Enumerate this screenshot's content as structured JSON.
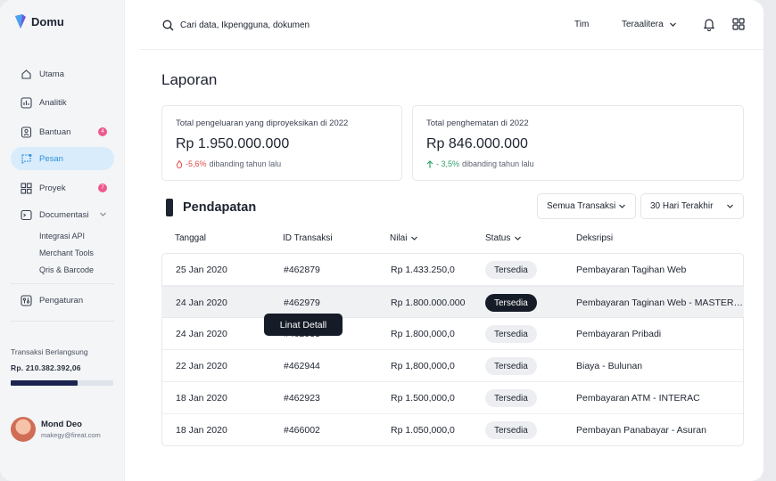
{
  "app": {
    "brand": "Domu"
  },
  "sidebar": {
    "items": [
      {
        "label": "Utama",
        "icon": "home-icon"
      },
      {
        "label": "Analitik",
        "icon": "chart-icon"
      },
      {
        "label": "Bantuan",
        "icon": "help-icon",
        "badge": "4"
      },
      {
        "label": "Pesan",
        "icon": "message-icon",
        "active": true
      },
      {
        "label": "Proyek",
        "icon": "grid-icon",
        "badge": "7"
      },
      {
        "label": "Documentasi",
        "icon": "terminal-icon"
      }
    ],
    "subitems": [
      "Integrasi API",
      "Merchant Tools",
      "Qris & Barcode"
    ],
    "settings_label": "Pengaturan",
    "transaction": {
      "label": "Transaksi Berlangsung",
      "value": "Rp. 210.382.392,06",
      "progress": 0.65
    },
    "user": {
      "name": "Mond Deo",
      "email": "makegy@fireat.com"
    }
  },
  "topbar": {
    "search_placeholder": "Cari data, Ikpengguna, dokumen",
    "team_label": "Tim",
    "account_label": "Teraalitera"
  },
  "main": {
    "title": "Laporan",
    "cards": [
      {
        "label": "Total pengeluaran yang diproyeksikan di 2022",
        "value": "Rp 1.950.000.000",
        "trend": "-5,6%",
        "trend_text": "dibanding tahun lalu",
        "direction": "down"
      },
      {
        "label": "Total penghematan di 2022",
        "value": "Rp 846.000.000",
        "trend": "- 3,5%",
        "trend_text": "dibanding tahun lalu",
        "direction": "up"
      }
    ],
    "section_title": "Pendapatan",
    "filter_type": "Semua Transaksi",
    "filter_range": "30 Hari Terakhir",
    "columns": [
      "Tanggal",
      "ID Transaksi",
      "Nilai",
      "Status",
      "Deksripsi"
    ],
    "rows": [
      {
        "date": "25 Jan 2020",
        "id": "#462879",
        "value": "Rp 1.433.250,0",
        "status": "Tersedia",
        "desc": "Pembayaran Tagihan Web"
      },
      {
        "date": "24 Jan 2020",
        "id": "#462979",
        "value": "Rp 1.800.000.000",
        "status": "Tersedia",
        "desc": "Pembayaran Taginan Web - MASTER…",
        "highlight": true
      },
      {
        "date": "24 Jan 2020",
        "id": "#462933",
        "value": "Rp 1.800,000,0",
        "status": "Tersedia",
        "desc": "Pembayaran Pribadi"
      },
      {
        "date": "22 Jan 2020",
        "id": "#462944",
        "value": "Rp 1,800,000,0",
        "status": "Tersedia",
        "desc": "Biaya - Bulunan"
      },
      {
        "date": "18 Jan 2020",
        "id": "#462923",
        "value": "Rp 1.500,000,0",
        "status": "Tersedia",
        "desc": "Pembayaran ATM - INTERAC"
      },
      {
        "date": "18 Jan 2020",
        "id": "#466002",
        "value": "Rp 1.050,000,0",
        "status": "Tersedia",
        "desc": "Pembayan Panabayar - Asuran"
      }
    ],
    "tooltip": "Linat Detall"
  },
  "colors": {
    "accent": "#2f8fd9",
    "active_bg": "#d8ecfb",
    "badge": "#ee5a8c",
    "dark": "#161c27",
    "down": "#e34b4b",
    "up": "#2fa36b"
  }
}
